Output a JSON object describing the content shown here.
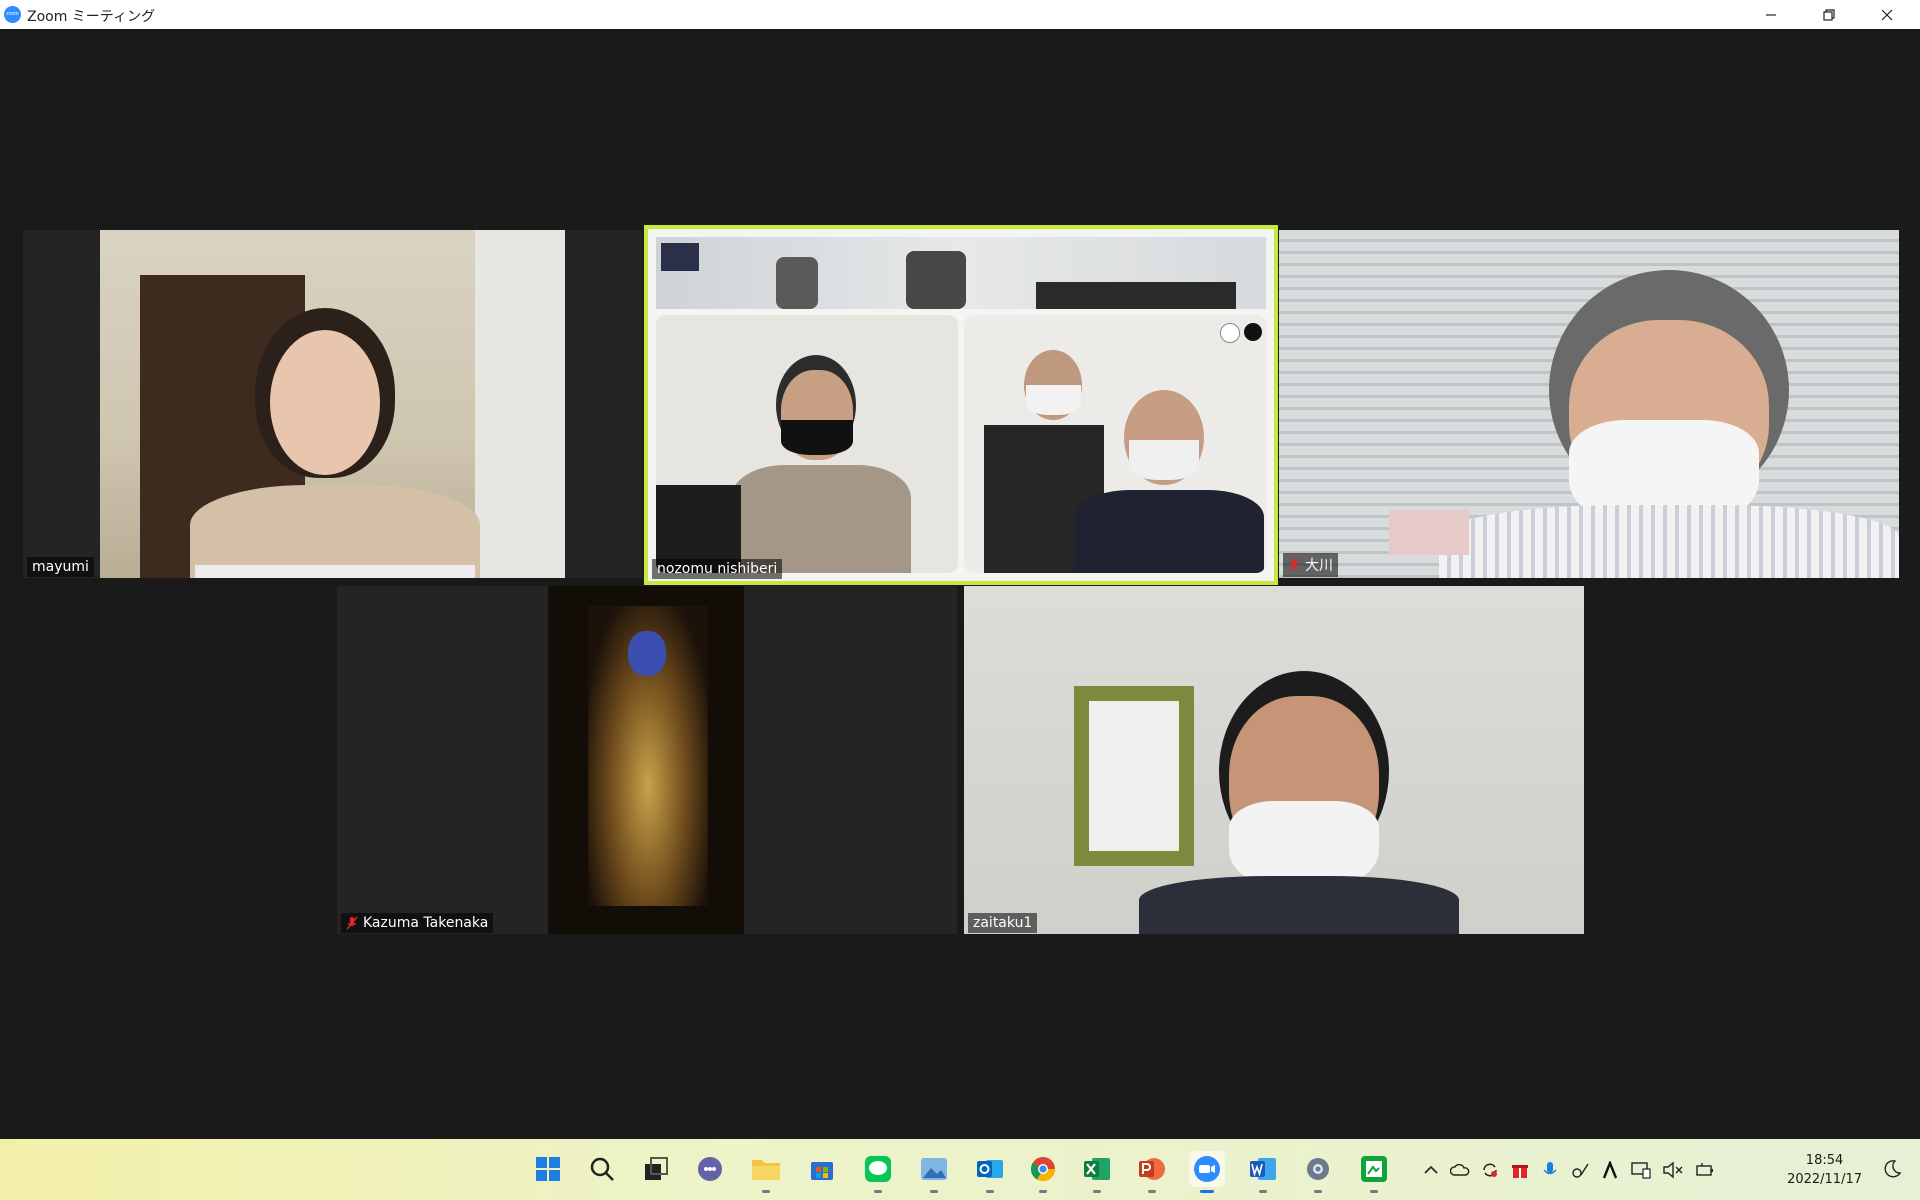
{
  "window": {
    "title": "Zoom ミーティング",
    "app_icon": "zoom-logo-icon",
    "app_icon_text": "zoom",
    "controls": [
      "minimize-icon",
      "restore-icon",
      "close-icon"
    ]
  },
  "colors": {
    "active_speaker_border": "#c5ea3d",
    "stage_background": "#1a1a1a",
    "muted_icon": "#e02828",
    "zoom_brand": "#2D8CFF"
  },
  "participants": [
    {
      "name": "mayumi",
      "muted": false
    },
    {
      "name": "nozomu nishiberi",
      "muted": false,
      "active_speaker": true
    },
    {
      "name": "大川",
      "muted": true
    },
    {
      "name": "Kazuma Takenaka",
      "muted": true
    },
    {
      "name": "zaitaku1",
      "muted": false
    }
  ],
  "taskbar": {
    "apps": [
      {
        "name": "start-icon",
        "running": false
      },
      {
        "name": "search-icon",
        "running": false
      },
      {
        "name": "task-view-icon",
        "running": false
      },
      {
        "name": "teams-chat-icon",
        "running": false
      },
      {
        "name": "file-explorer-icon",
        "running": true
      },
      {
        "name": "store-icon",
        "running": false
      },
      {
        "name": "line-icon",
        "running": true
      },
      {
        "name": "photos-icon",
        "running": true
      },
      {
        "name": "outlook-icon",
        "running": true
      },
      {
        "name": "chrome-icon",
        "running": true
      },
      {
        "name": "excel-icon",
        "running": true
      },
      {
        "name": "powerpoint-icon",
        "running": true
      },
      {
        "name": "zoom-icon",
        "running": true,
        "active": true
      },
      {
        "name": "word-icon",
        "running": true
      },
      {
        "name": "settings-icon",
        "running": true
      },
      {
        "name": "green-app-icon",
        "running": true
      }
    ],
    "tray_icons": [
      "chevron-up-icon",
      "onedrive-icon",
      "sync-icon",
      "gift-icon",
      "microphone-icon",
      "network-icon",
      "font-a-icon",
      "display-icon",
      "volume-muted-icon",
      "battery-icon"
    ],
    "time": "18:54",
    "date": "2022/11/17",
    "notification_icon": "moon-icon"
  }
}
